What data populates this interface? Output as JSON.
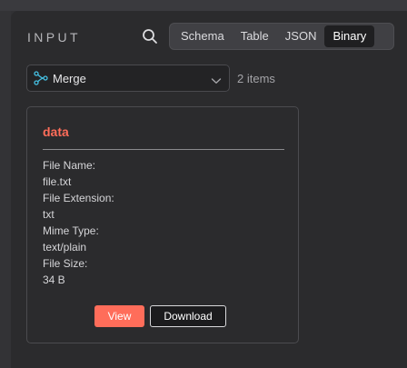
{
  "panel": {
    "title": "INPUT"
  },
  "toolbar": {
    "search_icon": "search-icon",
    "tabs": [
      {
        "label": "Schema",
        "active": false
      },
      {
        "label": "Table",
        "active": false
      },
      {
        "label": "JSON",
        "active": false
      },
      {
        "label": "Binary",
        "active": true
      }
    ]
  },
  "node_select": {
    "icon": "merge-node-icon",
    "value": "Merge",
    "item_count": "2 items"
  },
  "binary_item": {
    "key": "data",
    "fields": [
      {
        "label": "File Name:",
        "value": "file.txt"
      },
      {
        "label": "File Extension:",
        "value": "txt"
      },
      {
        "label": "Mime Type:",
        "value": "text/plain"
      },
      {
        "label": "File Size:",
        "value": "34 B"
      }
    ],
    "view_label": "View",
    "download_label": "Download"
  },
  "colors": {
    "accent": "#ff6d5a",
    "merge_icon": "#45c0e3",
    "panel_bg": "#2b2b2d",
    "active_tab_bg": "#1f1f21"
  }
}
